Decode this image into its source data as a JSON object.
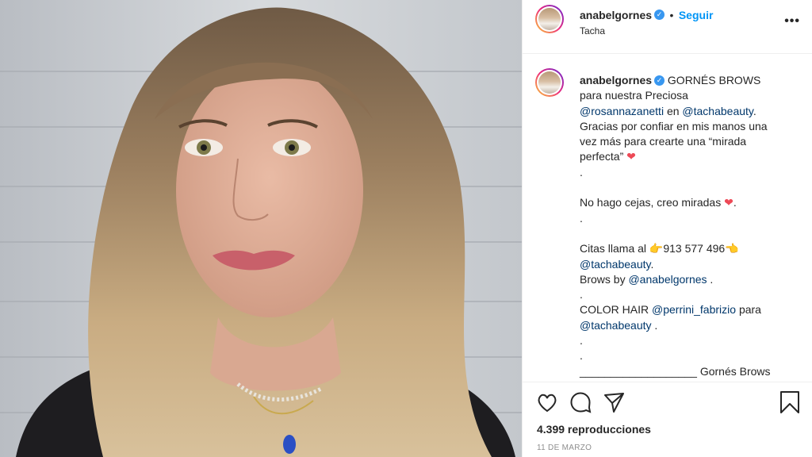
{
  "post": {
    "username": "anabelgornes",
    "follow_label": "Seguir",
    "separator": "•",
    "location": "Tacha",
    "more_label": "•••",
    "caption_lines": [
      [
        {
          "t": "GORNÉS BROWS"
        }
      ],
      [
        {
          "t": "para nuestra Preciosa"
        }
      ],
      [
        {
          "t": "@rosannazanetti",
          "m": 1
        },
        {
          "t": " en "
        },
        {
          "t": "@tachabeauty",
          "m": 1
        },
        {
          "t": "."
        }
      ],
      [
        {
          "t": "Gracias por confiar en mis manos una"
        }
      ],
      [
        {
          "t": "vez más para crearte una “mirada"
        }
      ],
      [
        {
          "t": "perfecta” "
        },
        {
          "t": "❤",
          "h": 1
        }
      ],
      [
        {
          "t": "."
        }
      ],
      [
        {
          "t": ""
        }
      ],
      [
        {
          "t": "No hago cejas, creo miradas "
        },
        {
          "t": "❤",
          "h": 1
        },
        {
          "t": "."
        }
      ],
      [
        {
          "t": "."
        }
      ],
      [
        {
          "t": ""
        }
      ],
      [
        {
          "t": "Citas llama al 👉913 577 496👈"
        }
      ],
      [
        {
          "t": "@tachabeauty",
          "m": 1
        },
        {
          "t": "."
        }
      ],
      [
        {
          "t": "Brows by "
        },
        {
          "t": "@anabelgornes",
          "m": 1
        },
        {
          "t": " ."
        }
      ],
      [
        {
          "t": "."
        }
      ],
      [
        {
          "t": "COLOR HAIR "
        },
        {
          "t": "@perrini_fabrizio",
          "m": 1
        },
        {
          "t": " para"
        }
      ],
      [
        {
          "t": "@tachabeauty",
          "m": 1
        },
        {
          "t": " ."
        }
      ],
      [
        {
          "t": "."
        }
      ],
      [
        {
          "t": "."
        }
      ],
      [
        {
          "t": "___________________ Gornés Brows"
        }
      ]
    ],
    "views": "4.399 reproducciones",
    "date": "11 DE MARZO"
  },
  "colors": {
    "accent": "#0095f6",
    "mention": "#00376b",
    "heart": "#ed4956",
    "verified": "#3897f0"
  },
  "icons": [
    "heart-icon",
    "comment-icon",
    "share-icon",
    "bookmark-icon",
    "verified-badge-icon",
    "more-options-icon"
  ]
}
